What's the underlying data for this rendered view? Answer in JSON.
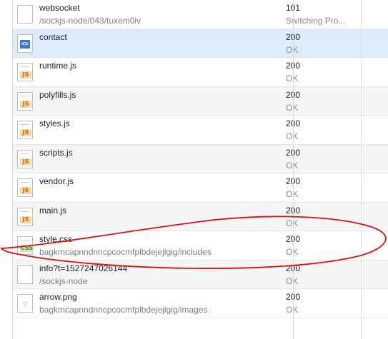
{
  "requests": [
    {
      "name": "websocket",
      "path": "/sockjs-node/043/tuxem0iv",
      "status": "101",
      "status_text": "Switching Pro...",
      "icon": "blank-file-icon"
    },
    {
      "name": "contact",
      "path": "",
      "status": "200",
      "status_text": "OK",
      "icon": "document-icon",
      "selected": true
    },
    {
      "name": "runtime.js",
      "path": "",
      "status": "200",
      "status_text": "OK",
      "icon": "js-file-icon"
    },
    {
      "name": "polyfills.js",
      "path": "",
      "status": "200",
      "status_text": "OK",
      "icon": "js-file-icon"
    },
    {
      "name": "styles.js",
      "path": "",
      "status": "200",
      "status_text": "OK",
      "icon": "js-file-icon"
    },
    {
      "name": "scripts.js",
      "path": "",
      "status": "200",
      "status_text": "OK",
      "icon": "js-file-icon"
    },
    {
      "name": "vendor.js",
      "path": "",
      "status": "200",
      "status_text": "OK",
      "icon": "js-file-icon"
    },
    {
      "name": "main.js",
      "path": "",
      "status": "200",
      "status_text": "OK",
      "icon": "js-file-icon"
    },
    {
      "name": "style.css",
      "path": "bagkmcapnndnncpcocmfplbdejejlgig/includes",
      "status": "200",
      "status_text": "OK",
      "icon": "css-file-icon"
    },
    {
      "name": "info?t=1527247026144",
      "path": "/sockjs-node",
      "status": "200",
      "status_text": "OK",
      "icon": "blank-file-icon"
    },
    {
      "name": "arrow.png",
      "path": "bagkmcapnndnncpcocmfplbdejejlgig/images",
      "status": "200",
      "status_text": "OK",
      "icon": "image-file-icon"
    }
  ],
  "badges": {
    "js": "JS",
    "css": "CSS",
    "doc": "<>",
    "img": "▽"
  },
  "colors": {
    "selected_row": "#dcecfb",
    "annotation": "#e01010"
  }
}
